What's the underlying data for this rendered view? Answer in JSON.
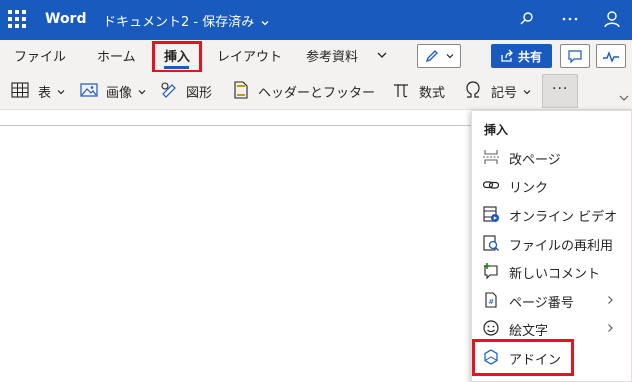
{
  "titlebar": {
    "app_name": "Word",
    "document_title": "ドキュメント2 - 保存済み"
  },
  "ribbon": {
    "tabs": [
      "ファイル",
      "ホーム",
      "挿入",
      "レイアウト",
      "参考資料"
    ],
    "active_tab": "挿入",
    "share_label": "共有"
  },
  "toolbar": {
    "table_label": "表",
    "image_label": "画像",
    "shapes_label": "図形",
    "header_footer_label": "ヘッダーとフッター",
    "equation_label": "数式",
    "symbol_label": "記号",
    "more_label": "···"
  },
  "insert_menu": {
    "header": "挿入",
    "items": [
      {
        "label": "改ページ",
        "icon": "page-break-icon",
        "submenu": false
      },
      {
        "label": "リンク",
        "icon": "link-icon",
        "submenu": false
      },
      {
        "label": "オンライン ビデオ",
        "icon": "online-video-icon",
        "submenu": false
      },
      {
        "label": "ファイルの再利用",
        "icon": "reuse-files-icon",
        "submenu": false
      },
      {
        "label": "新しいコメント",
        "icon": "new-comment-icon",
        "submenu": false
      },
      {
        "label": "ページ番号",
        "icon": "page-number-icon",
        "submenu": true
      },
      {
        "label": "絵文字",
        "icon": "emoji-icon",
        "submenu": true
      },
      {
        "label": "アドイン",
        "icon": "add-ins-icon",
        "submenu": false
      }
    ]
  },
  "colors": {
    "brand_blue": "#185abd",
    "highlight_red": "#e81123",
    "ribbon_bg": "#f3f2f1"
  }
}
